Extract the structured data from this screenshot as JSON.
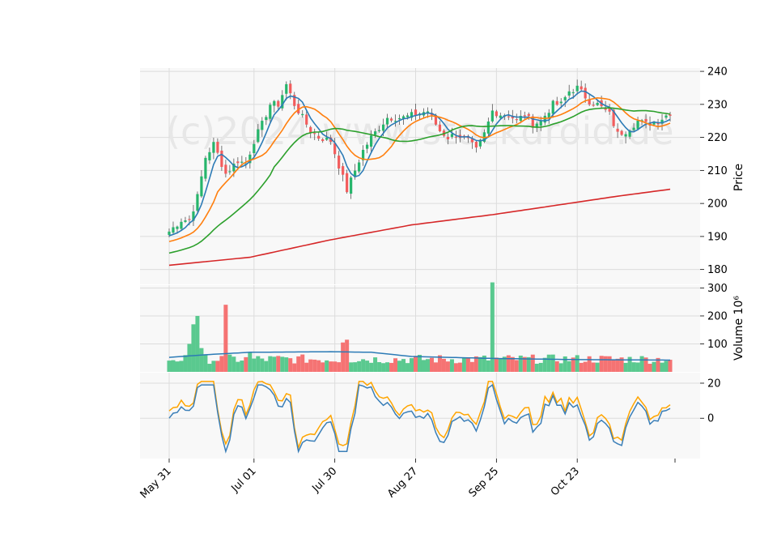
{
  "watermark": "(c)2024 www.stockdroid.de",
  "chart_data": {
    "type": "candlestick",
    "title": "",
    "n": 125,
    "start_date": "May 31",
    "x_tick_labels": [
      "May 31",
      "Jul 01",
      "Jul 30",
      "Aug 27",
      "Sep 25",
      "Oct 23"
    ],
    "x_tick_index": [
      0,
      21,
      41,
      61,
      81,
      101
    ],
    "grid": true,
    "panels": {
      "price": {
        "ylabel": "Price",
        "ylim": [
          175.5,
          241
        ],
        "yticks": [
          180,
          190,
          200,
          210,
          220,
          230,
          240
        ],
        "anchors": [
          [
            0,
            191.5
          ],
          [
            3,
            195
          ],
          [
            5,
            195
          ],
          [
            7,
            202
          ],
          [
            9,
            214
          ],
          [
            11,
            218
          ],
          [
            14,
            209
          ],
          [
            17,
            213
          ],
          [
            19,
            212
          ],
          [
            21,
            219
          ],
          [
            23,
            224
          ],
          [
            25,
            230
          ],
          [
            27,
            230
          ],
          [
            29,
            236
          ],
          [
            31,
            230
          ],
          [
            33,
            226
          ],
          [
            35,
            222
          ],
          [
            37,
            220
          ],
          [
            40,
            219
          ],
          [
            44,
            204
          ],
          [
            46,
            210
          ],
          [
            48,
            216
          ],
          [
            50,
            220
          ],
          [
            52,
            223
          ],
          [
            54,
            226
          ],
          [
            58,
            226
          ],
          [
            61,
            227
          ],
          [
            64,
            228
          ],
          [
            67,
            222
          ],
          [
            69,
            220
          ],
          [
            71,
            221
          ],
          [
            74,
            219
          ],
          [
            76,
            216
          ],
          [
            78,
            221
          ],
          [
            80,
            228
          ],
          [
            82,
            227
          ],
          [
            84,
            227
          ],
          [
            86,
            225
          ],
          [
            88,
            227
          ],
          [
            90,
            224
          ],
          [
            92,
            225
          ],
          [
            95,
            230
          ],
          [
            97,
            230
          ],
          [
            99,
            234
          ],
          [
            101,
            235
          ],
          [
            104,
            231
          ],
          [
            106,
            230
          ],
          [
            109,
            227
          ],
          [
            111,
            221
          ],
          [
            113,
            222
          ],
          [
            116,
            225
          ],
          [
            118,
            224
          ],
          [
            121,
            225
          ],
          [
            124,
            227.5
          ]
        ],
        "candles_up_color": "#26b56b",
        "candles_down_color": "#f25c5c",
        "moving_averages": [
          {
            "window": 5,
            "color": "#2c7bb6"
          },
          {
            "window": 12,
            "color": "#ff7f0e"
          },
          {
            "window": 26,
            "color": "#2ca02c"
          },
          {
            "window": 200,
            "color": "#d62728",
            "anchors": [
              [
                0,
                181.3
              ],
              [
                20,
                183.7
              ],
              [
                40,
                189.0
              ],
              [
                60,
                193.5
              ],
              [
                80,
                196.6
              ],
              [
                100,
                200.2
              ],
              [
                111,
                202.2
              ],
              [
                124,
                204.3
              ]
            ]
          }
        ]
      },
      "volume": {
        "ylabel": "Volume  10⁶",
        "ylim": [
          0,
          310
        ],
        "yticks": [
          100,
          200,
          300
        ],
        "ytick_labels": [
          "100",
          "200",
          "300"
        ],
        "base": 48,
        "spikes": [
          [
            5,
            100
          ],
          [
            6,
            170
          ],
          [
            7,
            200
          ],
          [
            8,
            85
          ],
          [
            14,
            240
          ],
          [
            20,
            70
          ],
          [
            43,
            105
          ],
          [
            44,
            115
          ],
          [
            80,
            320
          ]
        ],
        "avg_color": "#2c7bb6",
        "avg_anchors": [
          [
            0,
            52
          ],
          [
            10,
            62
          ],
          [
            20,
            70
          ],
          [
            40,
            72
          ],
          [
            50,
            70
          ],
          [
            60,
            55
          ],
          [
            80,
            48
          ],
          [
            100,
            44
          ],
          [
            124,
            42
          ]
        ]
      },
      "oscillator": {
        "ylim": [
          -23,
          26
        ],
        "yticks": [
          0,
          20
        ],
        "ytick_labels": [
          "0",
          "20"
        ],
        "series": [
          {
            "name": "",
            "color": "#3b7fb8"
          },
          {
            "name": "",
            "color": "#ffa500"
          }
        ]
      }
    }
  }
}
